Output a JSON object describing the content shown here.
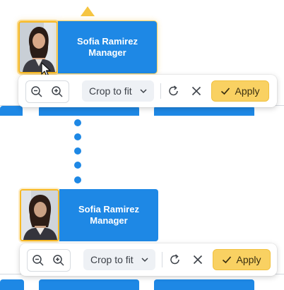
{
  "nodes": [
    {
      "name": "Sofia Ramirez",
      "title": "Manager"
    },
    {
      "name": "Sofia Ramirez",
      "title": "Manager"
    }
  ],
  "toolbars": [
    {
      "crop_select": "Crop to fit",
      "apply_label": "Apply"
    },
    {
      "crop_select": "Crop to fit",
      "apply_label": "Apply"
    }
  ],
  "icons": {
    "zoom_out": "zoom-out-icon",
    "zoom_in": "zoom-in-icon",
    "rotate": "rotate-icon",
    "close": "close-icon",
    "check": "check-icon",
    "chevron": "chevron-down-icon"
  },
  "colors": {
    "node_blue": "#1e88e5",
    "highlight": "#f7b924",
    "apply_bg": "#f9d162"
  }
}
